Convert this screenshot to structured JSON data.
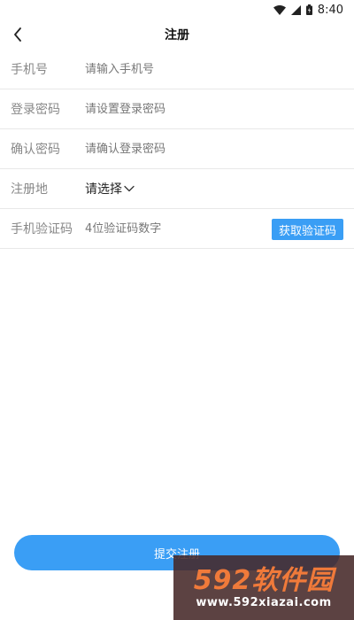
{
  "status_bar": {
    "time": "8:40",
    "icons": [
      "wifi-icon",
      "signal-icon",
      "battery-icon"
    ]
  },
  "nav": {
    "title": "注册",
    "back_icon": "chevron-left-icon"
  },
  "form": {
    "phone": {
      "label": "手机号",
      "placeholder": "请输入手机号"
    },
    "password": {
      "label": "登录密码",
      "placeholder": "请设置登录密码"
    },
    "confirm": {
      "label": "确认密码",
      "placeholder": "请确认登录密码"
    },
    "region": {
      "label": "注册地",
      "value": "请选择",
      "icon": "chevron-down-icon"
    },
    "code": {
      "label": "手机验证码",
      "placeholder": "4位验证码数字",
      "button": "获取验证码"
    }
  },
  "submit_label": "提交注册",
  "watermark": {
    "logo_text": "592软件园",
    "url": "www.592xiazai.com"
  },
  "colors": {
    "accent": "#3a9ef5",
    "watermark_orange": "#f07a3a"
  }
}
